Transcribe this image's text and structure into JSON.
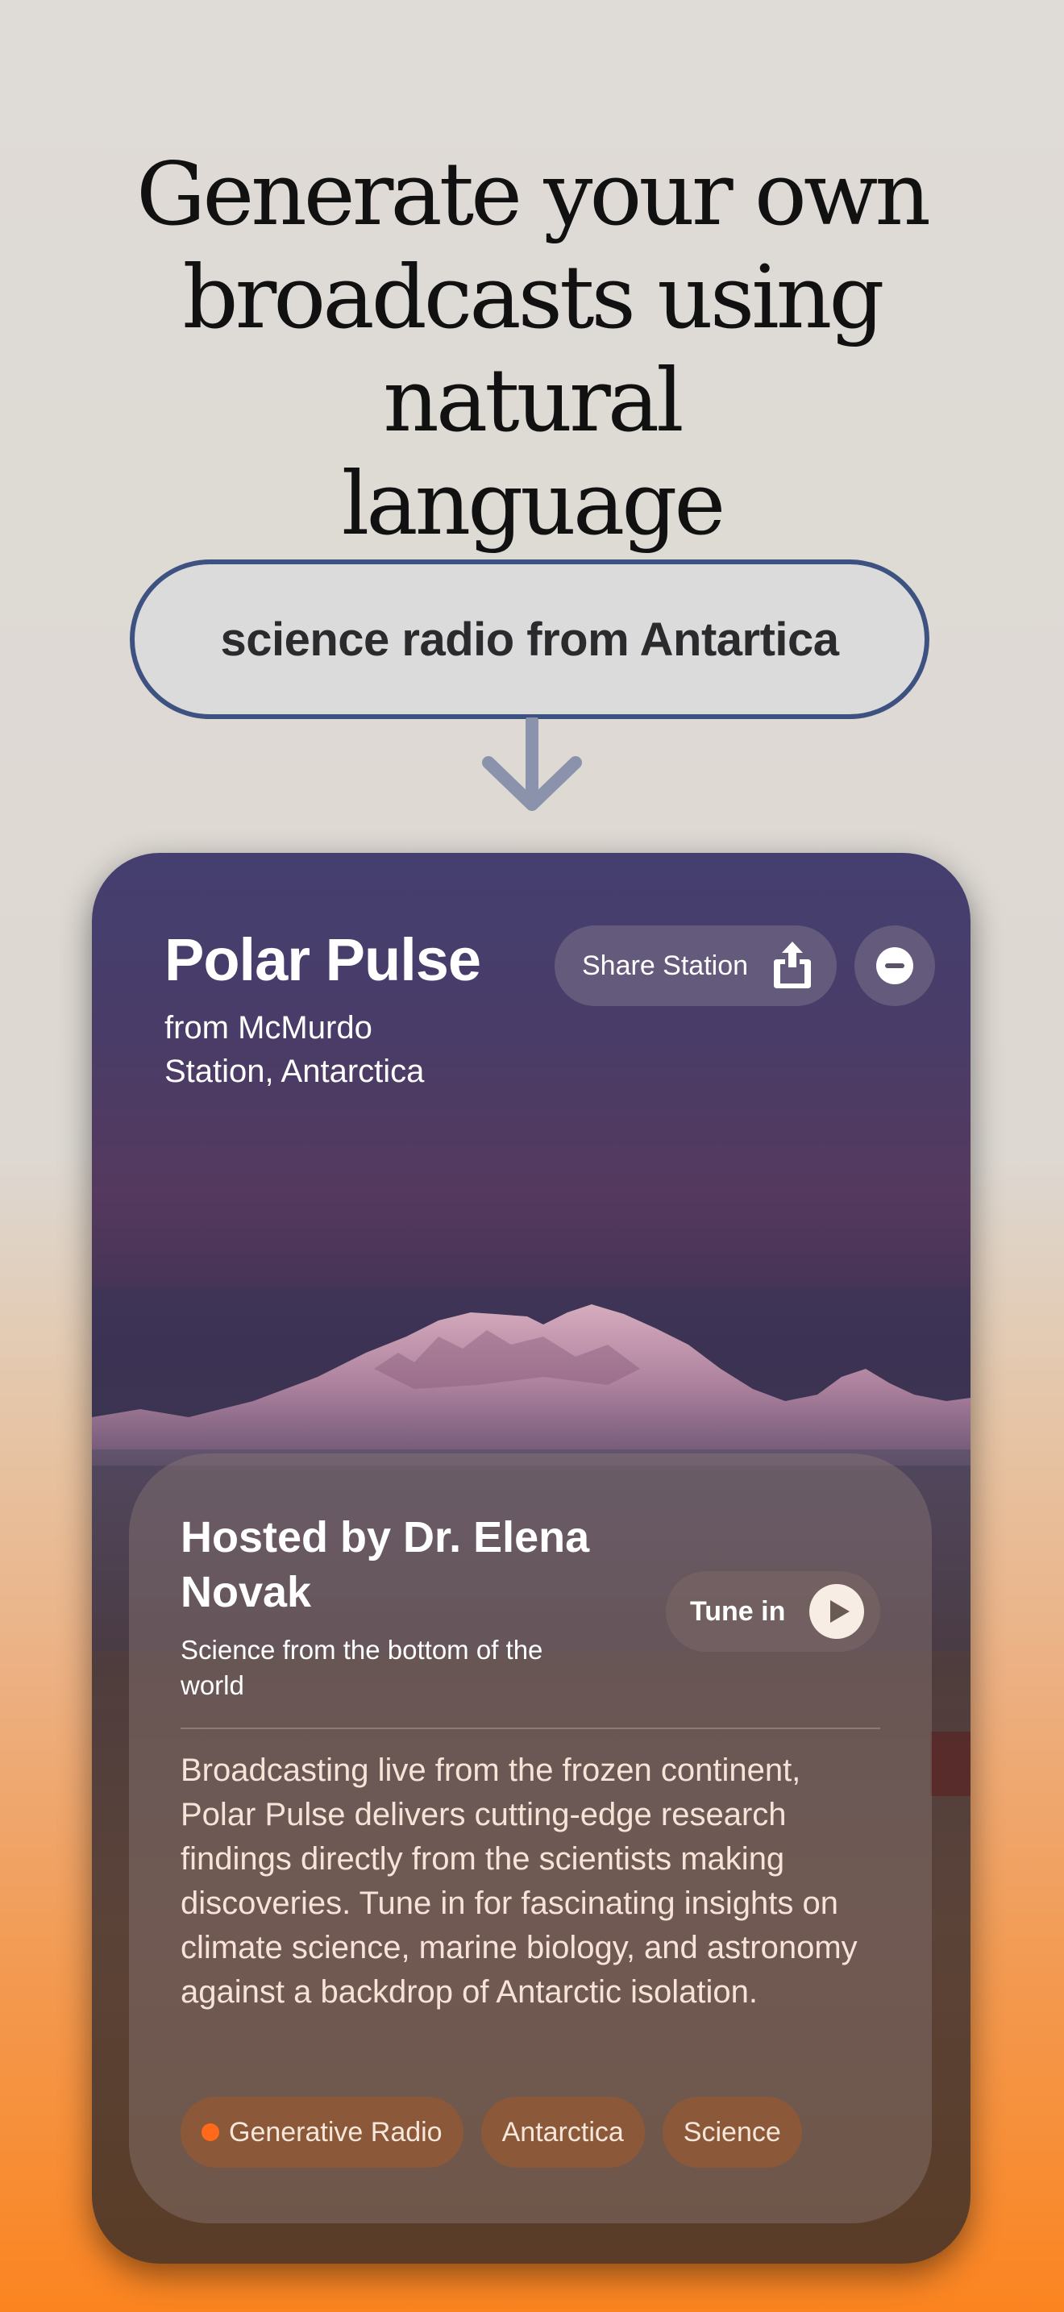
{
  "headline": {
    "lines": [
      "Generate your own",
      "broadcasts using natural",
      "language"
    ]
  },
  "prompt": {
    "text": "science radio from Antartica"
  },
  "colors": {
    "prompt_border": "#3e5281",
    "arrow": "#8a93ab",
    "tag_dot": "#ff6a1a",
    "bottom_orange": "#fb8420"
  },
  "station": {
    "title": "Polar Pulse",
    "location": "from McMurdo Station, Antarctica",
    "share_label": "Share Station",
    "share_icon": "share-icon",
    "remove_icon": "minus-circle-icon"
  },
  "host": {
    "name": "Hosted by Dr. Elena Novak",
    "tagline": "Science from the bottom of the world",
    "tune_label": "Tune in",
    "tune_icon": "play-icon"
  },
  "description": "Broadcasting live from the frozen continent, Polar Pulse delivers cutting-edge research findings directly from the scientists making discoveries. Tune in for fascinating insights on climate science, marine biology, and astronomy against a backdrop of Antarctic isolation.",
  "tags": [
    {
      "label": "Generative Radio",
      "dot": true
    },
    {
      "label": "Antarctica",
      "dot": false
    },
    {
      "label": "Science",
      "dot": false
    }
  ]
}
